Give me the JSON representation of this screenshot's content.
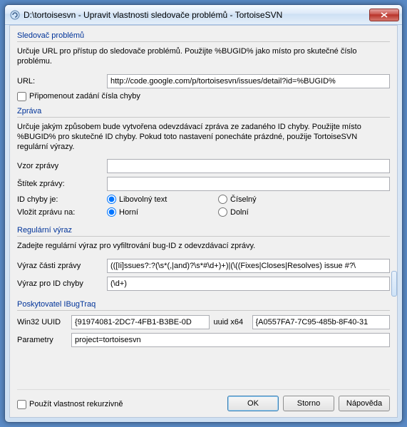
{
  "window": {
    "title": "D:\\tortoisesvn - Upravit vlastnosti sledovače problémů - TortoiseSVN"
  },
  "tracker": {
    "group_title": "Sledovač problémů",
    "desc": "Určuje URL pro přístup do sledovače problémů. Použijte %BUGID% jako místo pro skutečné číslo problému.",
    "url_label": "URL:",
    "url_value": "http://code.google.com/p/tortoisesvn/issues/detail?id=%BUGID%",
    "remind_label": "Připomenout zadání čísla chyby"
  },
  "message": {
    "group_title": "Zpráva",
    "desc": "Určuje jakým způsobem bude vytvořena odevzdávací zpráva ze zadaného ID chyby. Použijte místo %BUGID% pro skutečné ID chyby. Pokud toto nastavení ponecháte prázdné, použije TortoiseSVN regulární výrazy.",
    "pattern_label": "Vzor zprávy",
    "pattern_value": "",
    "tag_label": "Štítek zprávy:",
    "tag_value": "",
    "bugid_is_label": "ID chyby je:",
    "bugid_anytext": "Libovolný text",
    "bugid_numeric": "Číselný",
    "insert_label": "Vložit zprávu na:",
    "insert_top": "Horní",
    "insert_bottom": "Dolní"
  },
  "regex": {
    "group_title": "Regulární výraz",
    "desc": "Zadejte regulární výraz pro vyfiltrování bug-ID z odevzdávací zprávy.",
    "part_label": "Výraz části zprávy",
    "part_value": "(([Ii]ssues?:?(\\s*(,|and)?\\s*#\\d+)+)|(\\((Fixes|Closes|Resolves) issue #?\\",
    "id_label": "Výraz pro ID chyby",
    "id_value": "(\\d+)"
  },
  "provider": {
    "group_title": "Poskytovatel IBugTraq",
    "win32_label": "Win32 UUID",
    "win32_value": "{91974081-2DC7-4FB1-B3BE-0D",
    "x64_label": "uuid x64",
    "x64_value": "{A0557FA7-7C95-485b-8F40-31",
    "params_label": "Parametry",
    "params_value": "project=tortoisesvn"
  },
  "footer": {
    "recursive_label": "Použít vlastnost rekurzivně",
    "ok": "OK",
    "cancel": "Storno",
    "help": "Nápověda"
  }
}
